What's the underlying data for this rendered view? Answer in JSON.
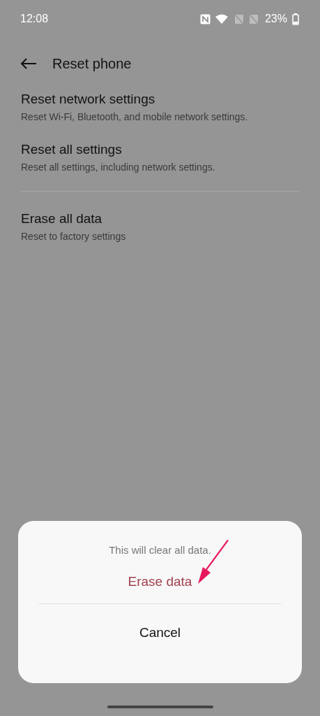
{
  "status_bar": {
    "time": "12:08",
    "battery": "23%"
  },
  "header": {
    "title": "Reset phone"
  },
  "sections": [
    [
      {
        "title": "Reset network settings",
        "subtitle": "Reset Wi-Fi, Bluetooth, and mobile network settings."
      },
      {
        "title": "Reset all settings",
        "subtitle": "Reset all settings, including network settings."
      }
    ],
    [
      {
        "title": "Erase all data",
        "subtitle": "Reset to factory settings"
      }
    ]
  ],
  "dialog": {
    "message": "This will clear all data.",
    "confirm": "Erase data",
    "cancel": "Cancel"
  }
}
